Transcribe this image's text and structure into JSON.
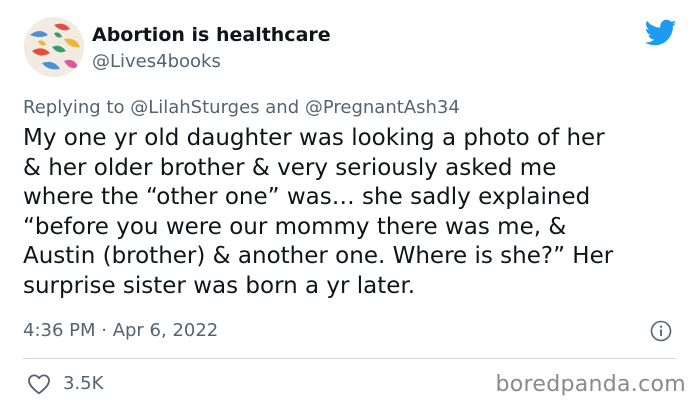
{
  "author": {
    "display_name": "Abortion is healthcare",
    "handle": "@Lives4books"
  },
  "reply": {
    "prefix": "Replying to ",
    "mention_1": "@LilahSturges",
    "joiner": " and ",
    "mention_2": "@PregnantAsh34"
  },
  "tweet": {
    "text": "My one yr old daughter was looking a photo of her\n& her older brother & very seriously asked me\nwhere the “other one” was… she sadly explained\n“before you were our mommy there was me, &\nAustin (brother) & another one. Where is she?” Her\nsurprise sister was born a yr later."
  },
  "meta": {
    "timestamp": "4:36 PM · Apr 6, 2022"
  },
  "engagement": {
    "likes": "3.5K"
  },
  "watermark": "boredpanda.com",
  "colors": {
    "twitter_blue": "#1d9bf0",
    "secondary_text": "#536471",
    "primary_text": "#0f1419"
  },
  "icons": [
    "twitter-bird-icon",
    "info-icon",
    "heart-icon"
  ]
}
